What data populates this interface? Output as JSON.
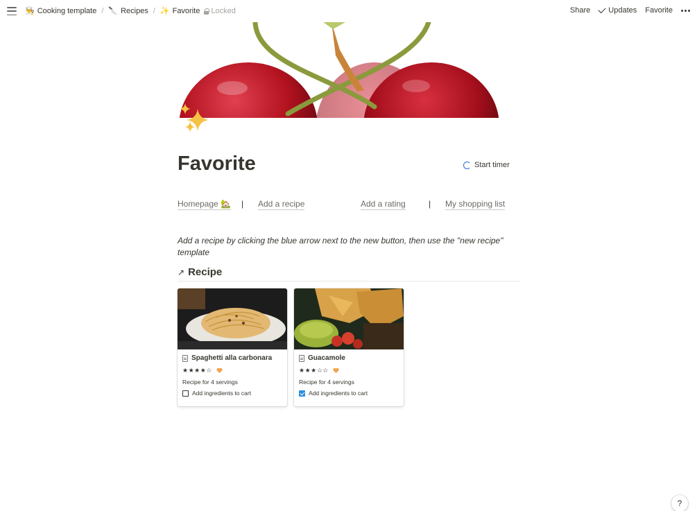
{
  "topbar": {
    "breadcrumbs": [
      {
        "emoji": "👨‍🍳",
        "label": "Cooking template"
      },
      {
        "emoji": "🔪",
        "label": "Recipes"
      },
      {
        "emoji": "✨",
        "label": "Favorite"
      }
    ],
    "locked_label": "Locked",
    "share_label": "Share",
    "updates_label": "Updates",
    "favorite_label": "Favorite"
  },
  "page": {
    "title": "Favorite",
    "timer_label": "Start timer",
    "nav_links": {
      "homepage": "Homepage 🏡",
      "add_recipe": "Add a recipe",
      "add_rating": "Add a rating",
      "shopping_list": "My shopping list",
      "separator": "|"
    },
    "hint": "Add a recipe by clicking the blue arrow next to the new button, then use the \"new recipe\" template",
    "section": {
      "arrow": "↗",
      "title": "Recipe"
    }
  },
  "cards": [
    {
      "title": "Spaghetti alla carbonara",
      "stars": "★★★★☆",
      "servings": "Recipe for 4 servings",
      "cart_label": "Add ingredients to cart",
      "cart_checked": false
    },
    {
      "title": "Guacamole",
      "stars": "★★★☆☆",
      "servings": "Recipe for 4 servings",
      "cart_label": "Add ingredients to cart",
      "cart_checked": true
    }
  ],
  "help_label": "?",
  "colors": {
    "text": "#37352f",
    "accent_blue": "#2e8fe0",
    "heart": "#f5a04a",
    "cherry": "#b3121f"
  }
}
